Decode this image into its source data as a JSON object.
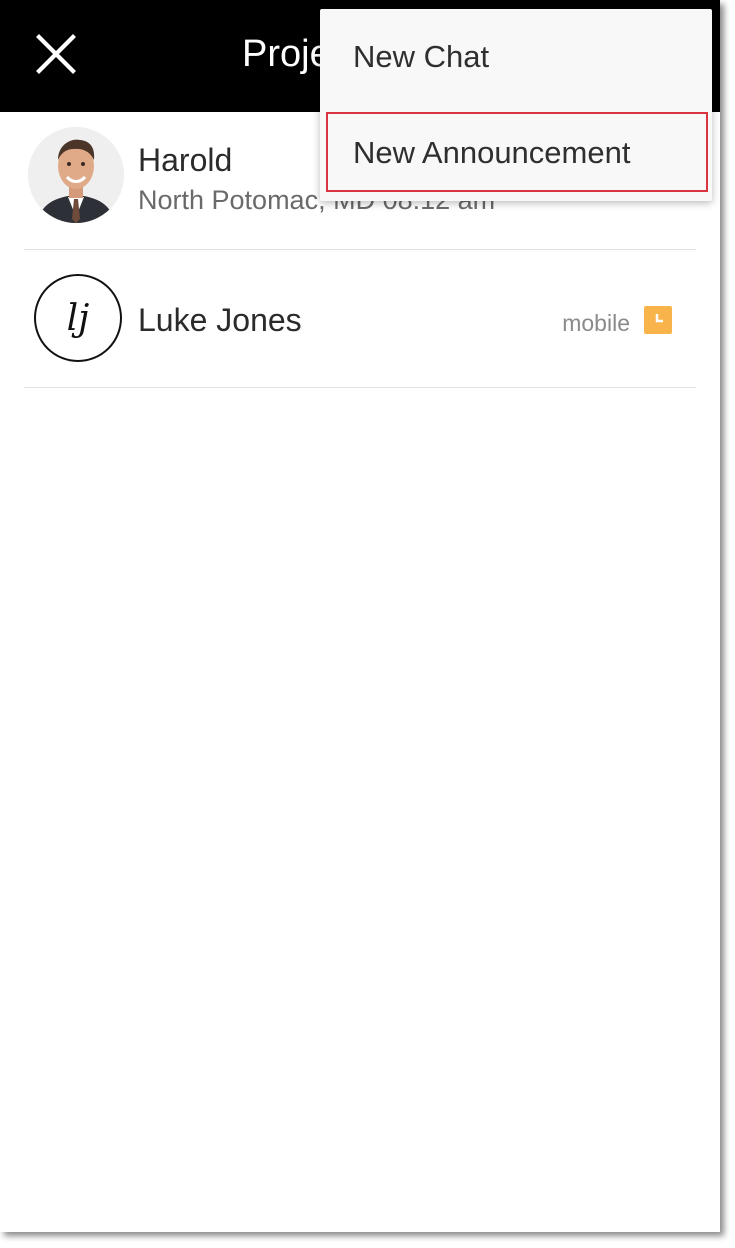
{
  "header": {
    "title": "Proje"
  },
  "menu": {
    "items": [
      {
        "label": "New Chat"
      },
      {
        "label": "New Announcement"
      }
    ],
    "highlight_color": "#d9343f"
  },
  "contacts": [
    {
      "name": "Harold",
      "location_time": "North Potomac, MD 08:12 am",
      "avatar": "profile-photo"
    },
    {
      "name": "Luke Jones",
      "initials": "lj",
      "device": "mobile",
      "status_icon": "status-clock-icon",
      "status_color": "#f8b44a"
    }
  ]
}
